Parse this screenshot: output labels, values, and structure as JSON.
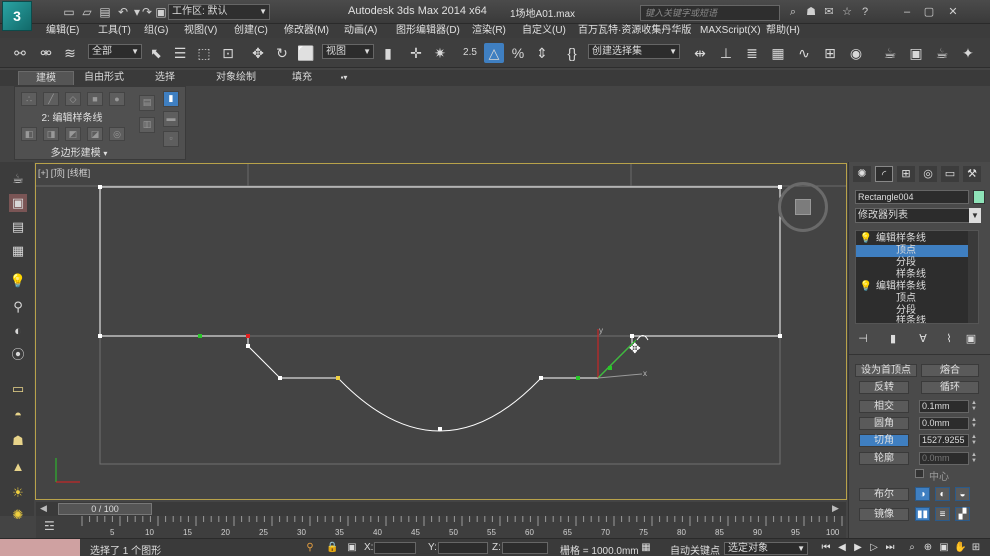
{
  "title_bar": {
    "logo_letter": "3",
    "workspace_label": "工作区: 默认",
    "app_title": "Autodesk 3ds Max  2014 x64",
    "file_name": "1场地A01.max",
    "search_placeholder": "键入关键字或短语"
  },
  "menu": {
    "items": [
      "编辑(E)",
      "工具(T)",
      "组(G)",
      "视图(V)",
      "创建(C)",
      "修改器(M)",
      "动画(A)",
      "图形编辑器(D)",
      "渲染(R)",
      "自定义(U)",
      "百万瓦特·资源收集丹华版",
      "MAXScript(X)",
      "帮助(H)"
    ]
  },
  "toolbar": {
    "selection_filter": "全部",
    "reference_coord": "视图",
    "snap_value": "2.5",
    "named_selection": "创建选择集"
  },
  "ribbon": {
    "tabs": [
      "建模",
      "自由形式",
      "选择",
      "对象绘制",
      "填充"
    ],
    "level_label": "2: 编辑样条线",
    "footer_label": "多边形建模"
  },
  "viewport": {
    "label": "[+] [顶] [线框]",
    "axis_x": "x",
    "axis_y": "y"
  },
  "command_panel": {
    "object_name": "Rectangle004",
    "object_color": "#8ee3b8",
    "modifier_list": "修改器列表",
    "stack": [
      {
        "label": "编辑样条线",
        "level": 0
      },
      {
        "label": "顶点",
        "level": 1
      },
      {
        "label": "分段",
        "level": 1
      },
      {
        "label": "样条线",
        "level": 1
      },
      {
        "label": "编辑样条线",
        "level": 0
      },
      {
        "label": "顶点",
        "level": 1
      },
      {
        "label": "分段",
        "level": 1
      },
      {
        "label": "样条线",
        "level": 1
      }
    ],
    "buttons": {
      "make_first": "设为首顶点",
      "fuse": "熔合",
      "reverse": "反转",
      "cycle": "循环",
      "cross_insert": "相交",
      "fillet": "圆角",
      "chamfer": "切角",
      "outline": "轮廓",
      "boolean": "布尔",
      "mirror": "镜像"
    },
    "values": {
      "cross_insert": "0.1mm",
      "fillet": "0.0mm",
      "chamfer": "1527.9255",
      "outline": "0.0mm"
    },
    "center_label": "中心"
  },
  "time_slider": {
    "position": "0 / 100",
    "ticks": [
      "5",
      "10",
      "15",
      "20",
      "25",
      "30",
      "35",
      "40",
      "45",
      "50",
      "55",
      "60",
      "65",
      "70",
      "75",
      "80",
      "85",
      "90",
      "95",
      "100"
    ]
  },
  "status_bar": {
    "message": "选择了 1 个图形",
    "x_label": "X:",
    "y_label": "Y:",
    "z_label": "Z:",
    "grid": "栅格 = 1000.0mm",
    "auto_key": "自动关键点",
    "selected": "选定对象"
  },
  "colors": {
    "accent": "#3f7fc1",
    "viewport_border": "#b8a24a"
  }
}
